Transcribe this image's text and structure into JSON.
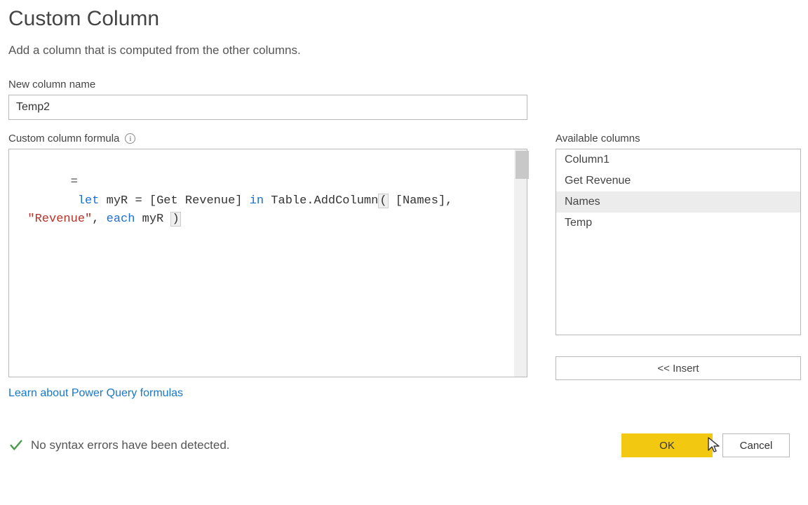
{
  "dialog": {
    "title": "Custom Column",
    "subtitle": "Add a column that is computed from the other columns."
  },
  "fields": {
    "new_column_name_label": "New column name",
    "new_column_name_value": "Temp2",
    "formula_label": "Custom column formula",
    "available_label": "Available columns"
  },
  "formula": {
    "tokens": {
      "eq": "=",
      "let": "let",
      "var": " myR ",
      "assign": "=",
      "open1": " [",
      "ref1": "Get Revenue",
      "close1": "] ",
      "in": "in",
      "fn": " Table.AddColumn",
      "lparen": "(",
      "open2": " [",
      "ref2": "Names",
      "close2": "],",
      "indent": "  ",
      "str": "\"Revenue\"",
      "comma": ", ",
      "each": "each",
      "tail": " myR ",
      "rparen": ")"
    }
  },
  "available_columns": [
    {
      "label": "Column1",
      "selected": false
    },
    {
      "label": "Get Revenue",
      "selected": false
    },
    {
      "label": "Names",
      "selected": true
    },
    {
      "label": "Temp",
      "selected": false
    }
  ],
  "insert_button": "<< Insert",
  "link_text": "Learn about Power Query formulas",
  "status_text": "No syntax errors have been detected.",
  "buttons": {
    "ok": "OK",
    "cancel": "Cancel"
  }
}
